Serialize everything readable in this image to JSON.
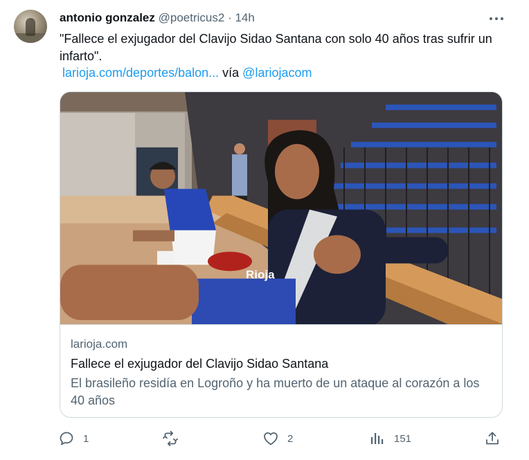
{
  "tweet": {
    "author_name": "antonio gonzalez",
    "author_handle": "@poetricus2",
    "separator": "·",
    "time": "14h",
    "text": "\"Fallece el exjugador del Clavijo Sidao Santana con solo 40 años tras sufrir un infarto\".",
    "link_text": "larioja.com/deportes/balon...",
    "via_text": "vía",
    "via_handle": "@lariojacom",
    "more_icon": "more-horizontal-icon"
  },
  "card": {
    "domain": "larioja.com",
    "title": "Fallece el exjugador del Clavijo Sidao Santana",
    "description": "El brasileño residía en Logroño y ha muerto de un ataque al corazón a los 40 años",
    "jersey_text": "Rioja"
  },
  "actions": {
    "reply": {
      "icon": "reply-icon",
      "count": "1"
    },
    "retweet": {
      "icon": "retweet-icon",
      "count": ""
    },
    "like": {
      "icon": "heart-icon",
      "count": "2"
    },
    "views": {
      "icon": "views-chart-icon",
      "count": "151"
    },
    "share": {
      "icon": "share-icon"
    }
  },
  "colors": {
    "accent": "#1d9bf0",
    "secondary_text": "#536471",
    "border": "#cfd9de"
  }
}
